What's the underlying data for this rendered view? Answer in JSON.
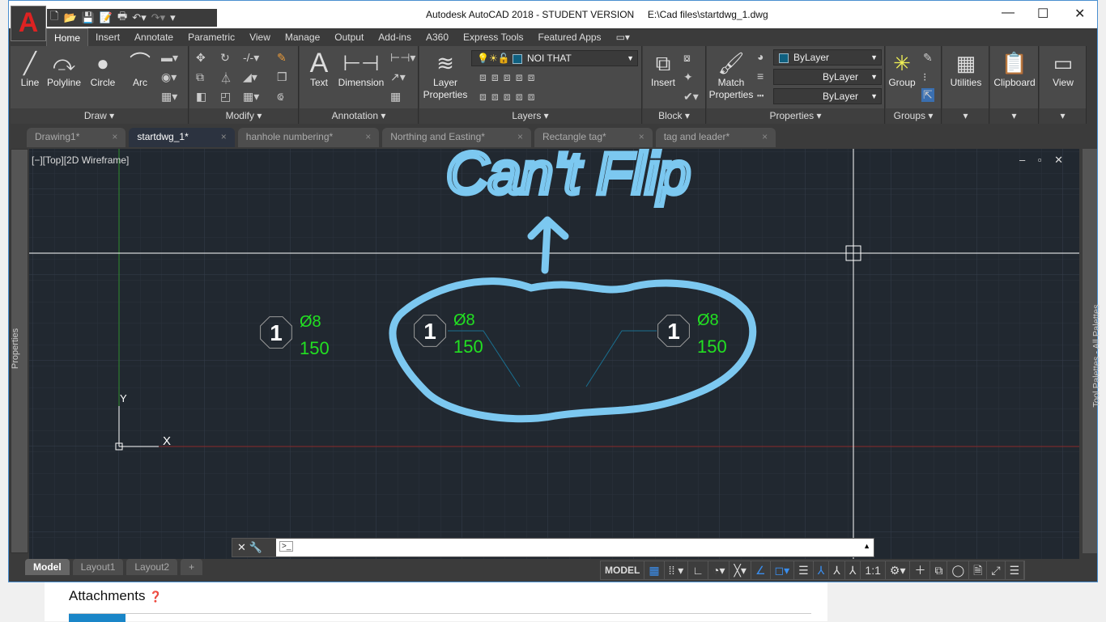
{
  "window": {
    "title": "Autodesk AutoCAD 2018 - STUDENT VERSION",
    "file": "E:\\Cad files\\startdwg_1.dwg",
    "app_letter": "A"
  },
  "ribbon_tabs": [
    "Home",
    "Insert",
    "Annotate",
    "Parametric",
    "View",
    "Manage",
    "Output",
    "Add-ins",
    "A360",
    "Express Tools",
    "Featured Apps"
  ],
  "panels": {
    "draw": {
      "title": "Draw ▾",
      "tools": [
        "Line",
        "Polyline",
        "Circle",
        "Arc"
      ]
    },
    "modify": {
      "title": "Modify ▾"
    },
    "annotation": {
      "title": "Annotation ▾",
      "tools": [
        "Text",
        "Dimension"
      ]
    },
    "layers": {
      "title": "Layers ▾",
      "tool": "Layer Properties",
      "current_layer": "NOI THAT"
    },
    "block": {
      "title": "Block ▾",
      "tool": "Insert"
    },
    "properties": {
      "title": "Properties ▾",
      "tool": "Match Properties",
      "color": "ByLayer",
      "linetype": "ByLayer",
      "lineweight": "ByLayer"
    },
    "groups": {
      "title": "Groups ▾",
      "tool": "Group"
    },
    "utilities": "Utilities",
    "clipboard": "Clipboard",
    "view": "View"
  },
  "doc_tabs": [
    {
      "label": "Drawing1*",
      "active": false
    },
    {
      "label": "startdwg_1*",
      "active": true
    },
    {
      "label": "hanhole numbering*",
      "active": false
    },
    {
      "label": "Northing and Easting*",
      "active": false
    },
    {
      "label": "Rectangle tag*",
      "active": false
    },
    {
      "label": "tag and leader*",
      "active": false
    }
  ],
  "viewport": {
    "label": "[−][Top][2D Wireframe]",
    "controls": "– ▫ ✕"
  },
  "palettes": {
    "left": "Properties",
    "right": "Tool Palettes - All Palettes"
  },
  "drawing": {
    "tags": [
      {
        "number": "1",
        "diameter": "Ø8",
        "length": "150"
      },
      {
        "number": "1",
        "diameter": "Ø8",
        "length": "150"
      },
      {
        "number": "1",
        "diameter": "Ø8",
        "length": "150"
      }
    ],
    "ucs": {
      "x": "X",
      "y": "Y"
    },
    "annotation_text": "Can't Flip",
    "colors": {
      "background": "#212830",
      "tag_text": "#22e022",
      "markup": "#7cc8f0",
      "leader": "#1a6f90"
    }
  },
  "command": {
    "value": "",
    "prompt_icon": ">_"
  },
  "layout_tabs": [
    "Model",
    "Layout1",
    "Layout2",
    "+"
  ],
  "status": {
    "mode": "MODEL",
    "scale": "1:1"
  },
  "background_page": {
    "heading": "Attachments"
  }
}
